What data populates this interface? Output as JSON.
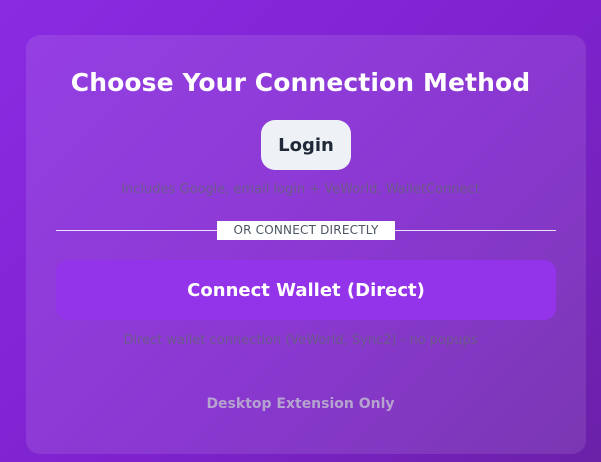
{
  "connection": {
    "title": "Choose Your Connection Method",
    "login_label": "Login",
    "login_hint": "Includes Google, email login + VeWorld, WalletConnect",
    "divider_label": "OR CONNECT DIRECTLY",
    "connect_label": "Connect Wallet (Direct)",
    "connect_hint": "Direct wallet connection (VeWorld, Sync2) - no popups",
    "desktop_note": "Desktop Extension Only"
  },
  "colors": {
    "background": "#8a2be2",
    "primary_button": "#9333ea",
    "login_button": "#eef1f5"
  }
}
